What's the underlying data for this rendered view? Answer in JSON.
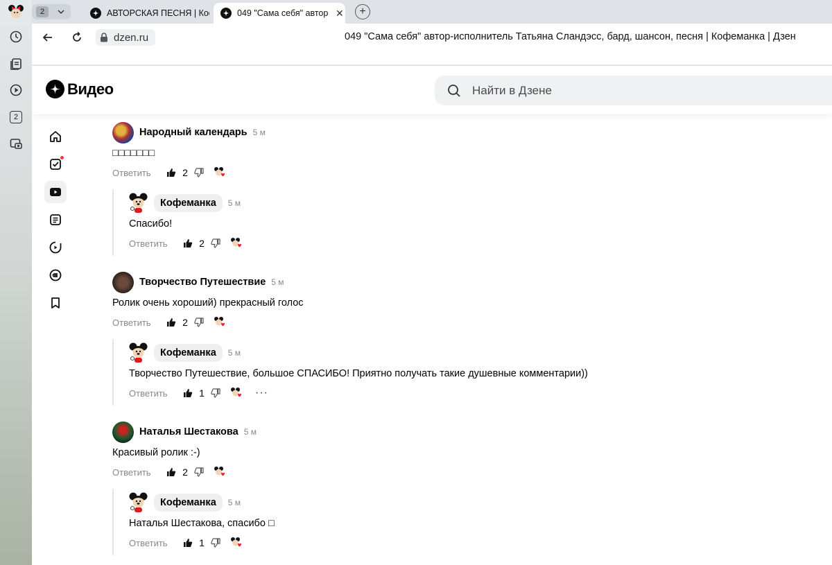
{
  "browser": {
    "tab_count": "2",
    "tabs": [
      {
        "title": "АВТОРСКАЯ ПЕСНЯ | Кофеманка"
      },
      {
        "title": "049 \"Сама себя\" автор-исполнитель"
      }
    ],
    "url": "dzen.ru",
    "page_title": "049 \"Сама себя\" автор-исполнитель Татьяна Сландэсс, бард, шансон, песня | Кофеманка | Дзен",
    "rail_badge": "2"
  },
  "header": {
    "logo_text": "Видео",
    "search_placeholder": "Найти в Дзене"
  },
  "actions": {
    "reply_label": "Ответить"
  },
  "comments": [
    {
      "author": "Народный календарь",
      "time": "5 м",
      "text": "□□□□□□□",
      "likes": "2",
      "reply": {
        "author": "Кофеманка",
        "time": "5 м",
        "text": "Спасибо!",
        "likes": "2"
      }
    },
    {
      "author": "Творчество Путешествие",
      "time": "5 м",
      "text": "Ролик очень хороший) прекрасный голос",
      "likes": "2",
      "reply": {
        "author": "Кофеманка",
        "time": "5 м",
        "text": "Творчество Путешествие, большое СПАСИБО! Приятно получать такие душевные комментарии))",
        "likes": "1"
      }
    },
    {
      "author": "Наталья Шестакова",
      "time": "5 м",
      "text": "Красивый ролик :-)",
      "likes": "2",
      "reply": {
        "author": "Кофеманка",
        "time": "5 м",
        "text": "Наталья Шестакова, спасибо □",
        "likes": "1"
      }
    }
  ],
  "icons": {
    "like": "thumb-up-icon",
    "dislike": "thumb-down-icon",
    "author_like": "mickey-heart-icon",
    "more": "more-icon"
  },
  "colors": {
    "notification_dot": "#ff3333",
    "meta_gray": "#888888"
  }
}
